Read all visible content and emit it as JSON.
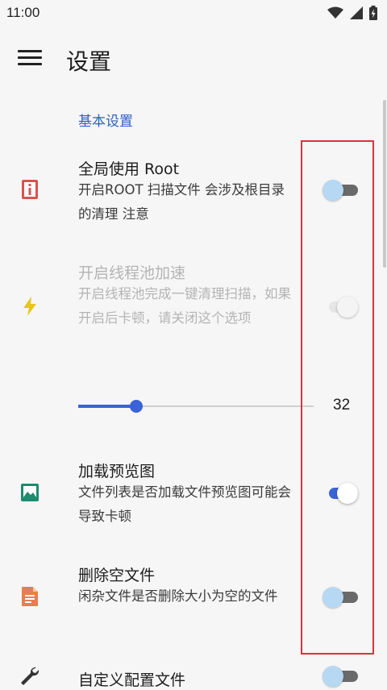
{
  "status_bar": {
    "time": "11:00",
    "icons": [
      "wifi-icon",
      "signal-icon",
      "battery-charging-icon"
    ]
  },
  "app_bar": {
    "title": "设置",
    "menu_icon": "menu-icon"
  },
  "section": {
    "title": "基本设置"
  },
  "settings": {
    "root": {
      "title": "全局使用 Root",
      "summary": "开启ROOT 扫描文件 会涉及根目录的清理 注意",
      "checked": false,
      "enabled": true,
      "icon": "root-info-icon"
    },
    "thread_pool": {
      "title": "开启线程池加速",
      "summary": "开启线程池完成一键清理扫描，如果开启后卡顿，请关闭这个选项",
      "checked": true,
      "enabled": false,
      "icon": "lightning-icon"
    },
    "thread_count": {
      "value": "32",
      "fraction": 0.245
    },
    "preview": {
      "title": "加载预览图",
      "summary": "文件列表是否加载文件预览图可能会导致卡顿",
      "checked": true,
      "enabled": true,
      "icon": "image-icon"
    },
    "delete_empty": {
      "title": "删除空文件",
      "summary": "闲杂文件是否删除大小为空的文件",
      "checked": false,
      "enabled": true,
      "icon": "document-icon"
    },
    "custom_config": {
      "title": "自定义配置文件",
      "checked": false,
      "enabled": true,
      "icon": "wrench-icon"
    }
  },
  "colors": {
    "accent": "#3b63d8",
    "section_header": "#2e5fc9",
    "highlight": "#d9333f",
    "root_icon": "#d9534f",
    "lightning_icon": "#e8c619",
    "image_icon": "#1e8a6e",
    "document_icon": "#e87e4d"
  }
}
